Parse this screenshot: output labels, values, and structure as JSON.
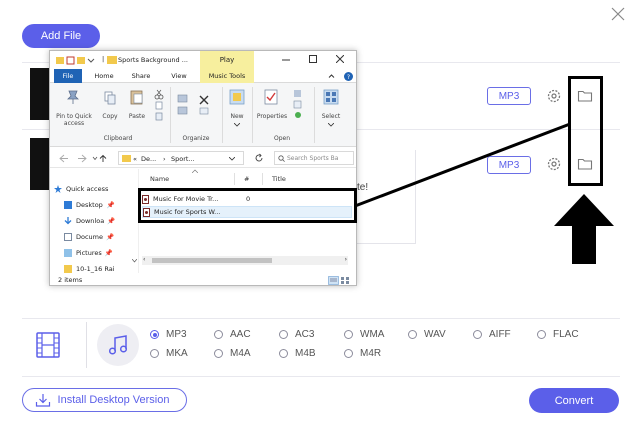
{
  "toolbar": {
    "add_file_label": "Add File"
  },
  "rows": [
    {
      "format": "MP3"
    },
    {
      "format": "MP3"
    }
  ],
  "behind_window_text": "te!",
  "explorer": {
    "title": "Sports Background ...",
    "contextual_tab": "Play",
    "tabs": [
      "File",
      "Home",
      "Share",
      "View",
      "Music Tools"
    ],
    "ribbon": {
      "pin_label": "Pin to Quick access",
      "copy_label": "Copy",
      "paste_label": "Paste",
      "clipboard_group": "Clipboard",
      "organize_group": "Organize",
      "new_label": "New",
      "properties_label": "Properties",
      "open_group": "Open",
      "select_label": "Select"
    },
    "address": {
      "part1": "De...",
      "part2": "Sport...",
      "search_placeholder": "Search Sports Ba"
    },
    "nav_items": [
      "Quick access",
      "Desktop",
      "Downloa",
      "Docume",
      "Pictures",
      "10-1_16 Rai"
    ],
    "columns": {
      "name": "Name",
      "number": "#",
      "title": "Title"
    },
    "files": [
      {
        "name": "Music For Movie Tr...",
        "number": "0"
      },
      {
        "name": "Music for Sports  W...",
        "number": ""
      }
    ],
    "status": "2 items"
  },
  "formats": {
    "options": [
      {
        "label": "MP3",
        "checked": true
      },
      {
        "label": "AAC",
        "checked": false
      },
      {
        "label": "AC3",
        "checked": false
      },
      {
        "label": "WMA",
        "checked": false
      },
      {
        "label": "WAV",
        "checked": false
      },
      {
        "label": "AIFF",
        "checked": false
      },
      {
        "label": "FLAC",
        "checked": false
      },
      {
        "label": "MKA",
        "checked": false
      },
      {
        "label": "M4A",
        "checked": false
      },
      {
        "label": "M4B",
        "checked": false
      },
      {
        "label": "M4R",
        "checked": false
      }
    ]
  },
  "bottom": {
    "install_label": "Install Desktop Version",
    "convert_label": "Convert"
  },
  "colors": {
    "accent": "#5b5fe9",
    "annotation": "#000000",
    "file_tab": "#1f63b5",
    "music_tools_tab": "#f7ef9e"
  }
}
